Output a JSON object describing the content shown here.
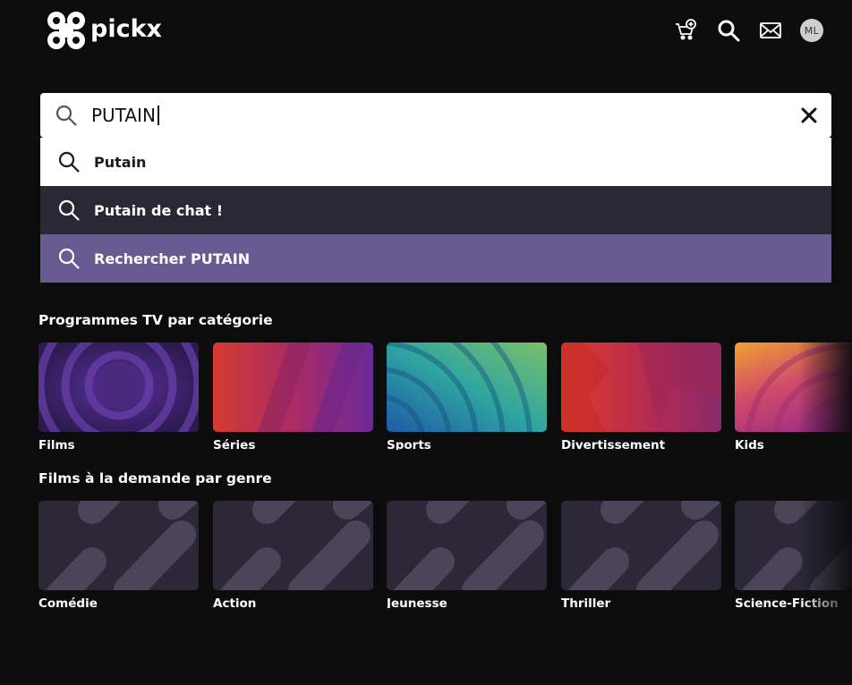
{
  "header": {
    "logo_text": "pickx",
    "avatar_initials": "ML",
    "icons": [
      "cart-add-icon",
      "search-icon",
      "mail-icon"
    ]
  },
  "search": {
    "value": "PUTAIN",
    "placeholder": ""
  },
  "suggestions": [
    {
      "label": "Putain"
    },
    {
      "label": "Putain de chat !"
    },
    {
      "label": "Rechercher PUTAIN"
    }
  ],
  "tv_section": {
    "title": "Programmes TV par catégorie",
    "items": [
      {
        "label": "Films"
      },
      {
        "label": "Séries"
      },
      {
        "label": "Sports"
      },
      {
        "label": "Divertissement"
      },
      {
        "label": "Kids"
      }
    ]
  },
  "vod_section": {
    "title": "Films à la demande par genre",
    "items": [
      {
        "label": "Comédie"
      },
      {
        "label": "Action"
      },
      {
        "label": "Jeunesse"
      },
      {
        "label": "Thriller"
      },
      {
        "label": "Science-Fiction"
      }
    ]
  },
  "colors": {
    "background": "#0c0c0d",
    "suggestion_active": "#6a5a92",
    "suggestion_hover": "#2a2834"
  }
}
